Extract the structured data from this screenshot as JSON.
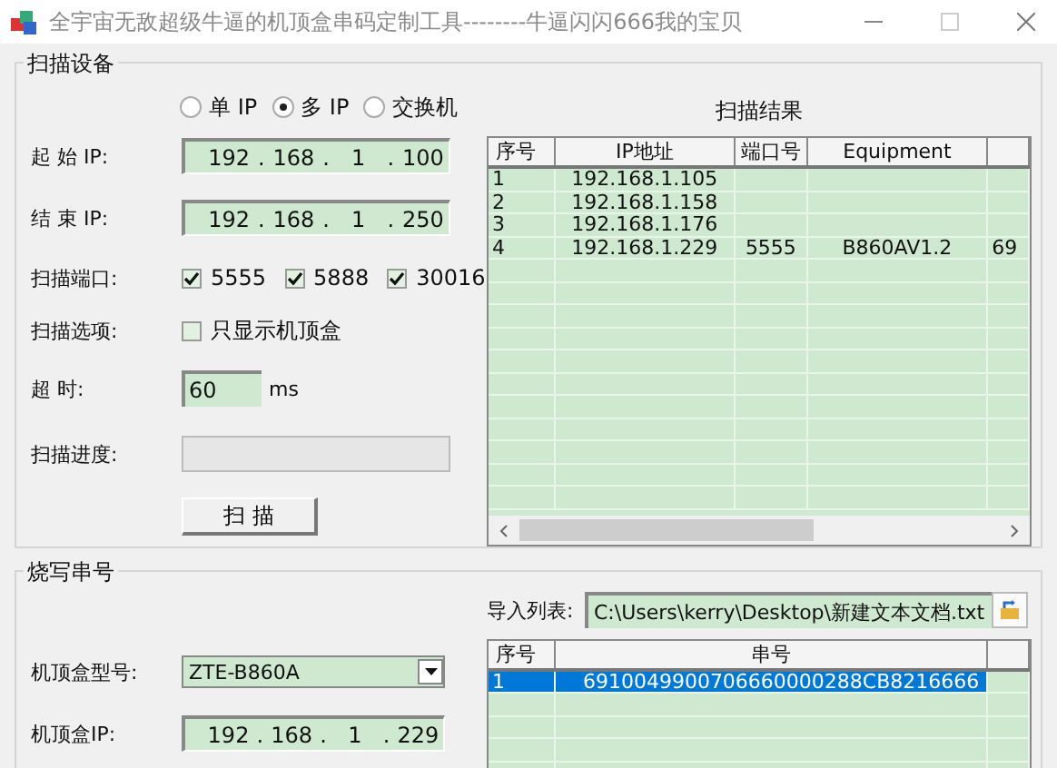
{
  "window": {
    "title": "全宇宙无敌超级牛逼的机顶盒串码定制工具--------牛逼闪闪666我的宝贝"
  },
  "scan": {
    "title": "扫描设备",
    "modes": [
      {
        "label": "单 IP",
        "selected": false
      },
      {
        "label": "多 IP",
        "selected": true
      },
      {
        "label": "交换机",
        "selected": false
      }
    ],
    "start_ip": {
      "label": "起 始 IP:",
      "octets": [
        "192",
        "168",
        "1",
        "100"
      ],
      "separator": "."
    },
    "end_ip": {
      "label": "结 束 IP:",
      "octets": [
        "192",
        "168",
        "1",
        "250"
      ],
      "separator": "."
    },
    "ports": {
      "label": "扫描端口:",
      "items": [
        {
          "label": "5555",
          "checked": true
        },
        {
          "label": "5888",
          "checked": true
        },
        {
          "label": "30016",
          "checked": true
        }
      ]
    },
    "option": {
      "label": "扫描选项:",
      "item": {
        "label": "只显示机顶盒",
        "checked": false
      }
    },
    "timeout": {
      "label": "超 时:",
      "value": "60",
      "unit": "ms"
    },
    "progress": {
      "label": "扫描进度:",
      "level": 0
    },
    "scan_button": "扫 描",
    "results": {
      "title": "扫描结果",
      "columns": [
        "序号",
        "IP地址",
        "端口号",
        "Equipment"
      ],
      "rows": [
        {
          "index": "1",
          "ip": "192.168.1.105"
        },
        {
          "index": "2",
          "ip": "192.168.1.158"
        },
        {
          "index": "3",
          "ip": "192.168.1.176"
        },
        {
          "index": "4",
          "ip": "192.168.1.229",
          "port": "5555",
          "equipment": "B860AV1.2",
          "column_5": "69"
        }
      ]
    }
  },
  "burn": {
    "title": "烧写串号",
    "import": {
      "label": "导入列表:",
      "path": "C:\\Users\\kerry\\Desktop\\新建文本文档.txt"
    },
    "model": {
      "label": "机顶盒型号:",
      "value": "ZTE-B860A"
    },
    "box_ip": {
      "label": "机顶盒IP:",
      "octets": [
        "192",
        "168",
        "1",
        "229"
      ],
      "separator": "."
    },
    "serials": {
      "columns": [
        "序号",
        "串号"
      ],
      "rows": [
        {
          "index": "1",
          "serial": "6910049900706660000288CB8216666",
          "selected": true
        }
      ]
    }
  }
}
